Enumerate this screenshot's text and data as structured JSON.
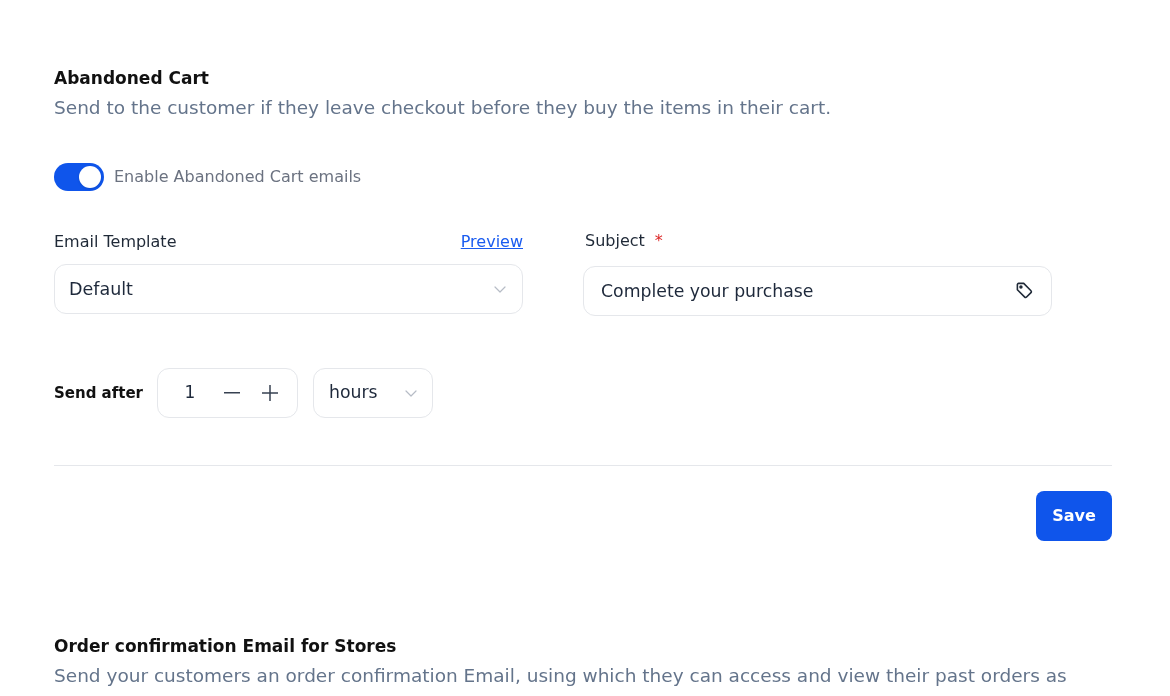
{
  "abandoned_cart": {
    "title": "Abandoned Cart",
    "description": "Send to the customer if they leave checkout before they buy the items in their cart.",
    "toggle": {
      "label": "Enable Abandoned Cart emails",
      "on": true
    },
    "email_template": {
      "label": "Email Template",
      "link": "Preview",
      "value": "Default"
    },
    "subject": {
      "label": "Subject",
      "required_mark": "*",
      "value": "Complete your purchase"
    },
    "send_after": {
      "label": "Send after",
      "value": "1",
      "unit": "hours"
    },
    "save_button": "Save"
  },
  "order_confirmation": {
    "title": "Order confirmation Email for Stores",
    "description": "Send your customers an order confirmation Email, using which they can access and view their past orders as"
  }
}
